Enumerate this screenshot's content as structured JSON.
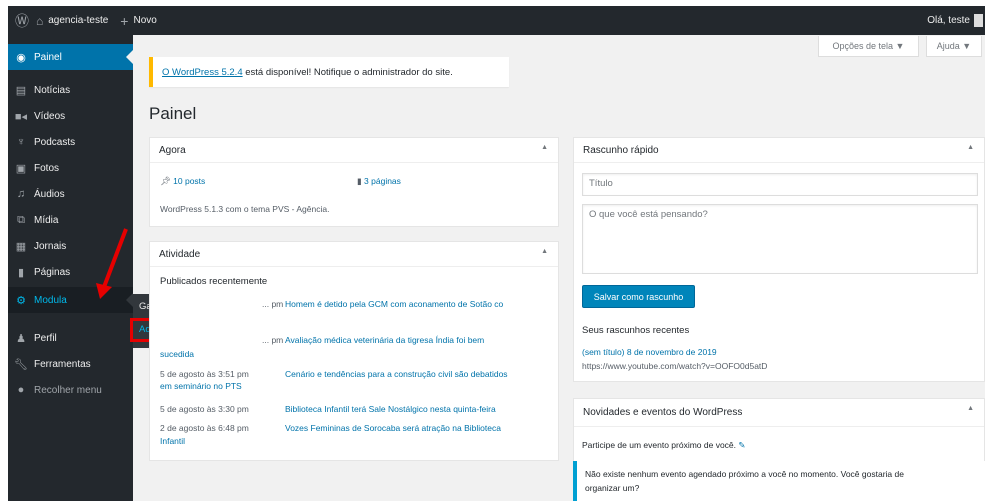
{
  "adminbar": {
    "site_name": "agencia-teste",
    "new_label": "Novo",
    "greeting": "Olá, teste"
  },
  "sidebar": {
    "items": [
      {
        "label": "Painel",
        "icon": "dashboard-icon"
      },
      {
        "label": "Notícias",
        "icon": "news-icon"
      },
      {
        "label": "Vídeos",
        "icon": "video-icon"
      },
      {
        "label": "Podcasts",
        "icon": "microphone-icon"
      },
      {
        "label": "Fotos",
        "icon": "photo-icon"
      },
      {
        "label": "Áudios",
        "icon": "audio-icon"
      },
      {
        "label": "Mídia",
        "icon": "media-icon"
      },
      {
        "label": "Jornais",
        "icon": "newspaper-icon"
      },
      {
        "label": "Páginas",
        "icon": "pages-icon"
      },
      {
        "label": "Modula",
        "icon": "gear-icon"
      },
      {
        "label": "Perfil",
        "icon": "user-icon"
      },
      {
        "label": "Ferramentas",
        "icon": "wrench-icon"
      },
      {
        "label": "Recolher menu",
        "icon": "collapse-icon"
      }
    ],
    "flyout": {
      "galleries": "Galleries",
      "add_new": "Add New"
    }
  },
  "screen_options": {
    "label": "Opções de tela ▼",
    "help": "Ajuda ▼"
  },
  "notice": {
    "link": "O WordPress 5.2.4",
    "text": " está disponível! Notifique o administrador do site."
  },
  "page_title": "Painel",
  "agora": {
    "title": "Agora",
    "posts": "10 posts",
    "pages": "3 páginas",
    "theme_text": "WordPress 5.1.3 com o tema PVS - Agência."
  },
  "atividade": {
    "title": "Atividade",
    "subtitle": "Publicados recentemente",
    "rows": [
      {
        "date": "... pm",
        "title": "Homem é detido pela GCM com aconamento de Sotão co"
      },
      {
        "date": "... pm",
        "title": "Avaliação médica veterinária da tigresa Índia foi bem"
      },
      {
        "date": "sucedida",
        "title": ""
      },
      {
        "date": "5 de agosto às 3:51 pm",
        "title": "Cenário e tendências para a construção civil são debatidos"
      },
      {
        "date": "em seminário no PTS",
        "title": ""
      },
      {
        "date": "5 de agosto às 3:30 pm",
        "title": "Biblioteca Infantil terá Sale Nostálgico nesta quinta-feira"
      },
      {
        "date": "2 de agosto às 6:48 pm",
        "title": "Vozes Femininas de Sorocaba será atração na Biblioteca"
      },
      {
        "date": "",
        "title": "Infantil"
      }
    ]
  },
  "rascunho": {
    "title": "Rascunho rápido",
    "title_placeholder": "Título",
    "content_placeholder": "O que você está pensando?",
    "save_label": "Salvar como rascunho",
    "recent_title": "Seus rascunhos recentes",
    "draft_line": "(sem título) 8 de novembro de 2019",
    "draft_url": "https://www.youtube.com/watch?v=OOFO0d5atD"
  },
  "eventos": {
    "title": "Novidades e eventos do WordPress",
    "participate": "Participe de um evento próximo de você.",
    "none_line1": "Não existe nenhum evento agendado próximo a você no momento. Você gostaria de",
    "none_line2": "organizar um?"
  },
  "colors": {
    "accent": "#0073aa",
    "adminbar": "#23282d",
    "highlight": "#e60000"
  }
}
